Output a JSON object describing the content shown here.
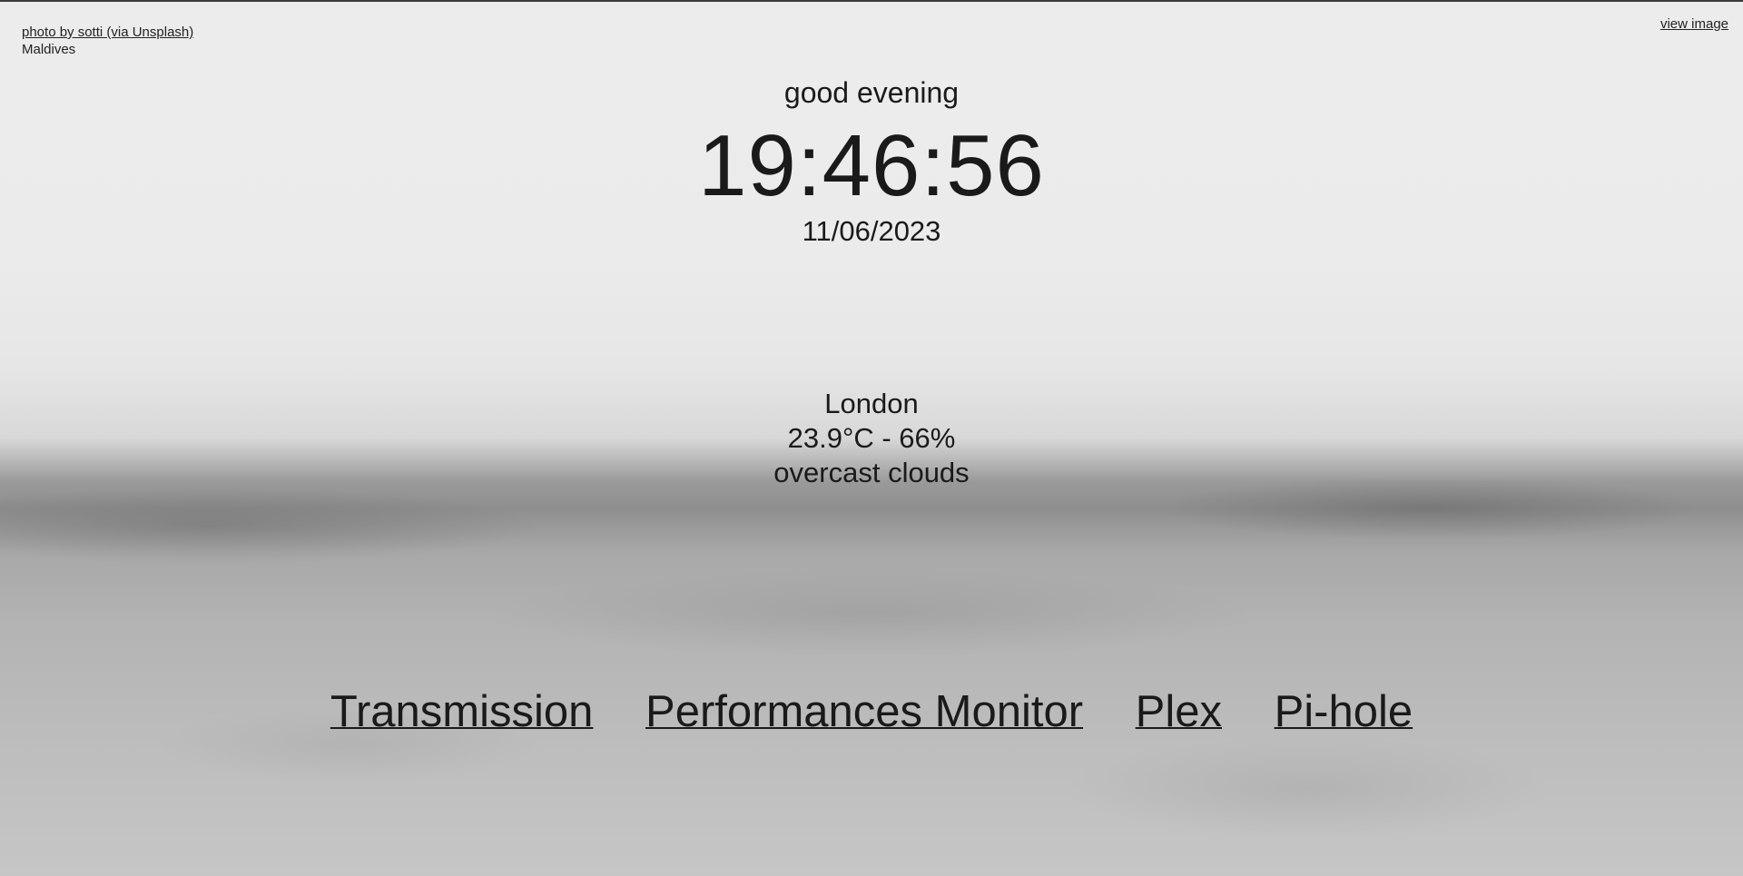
{
  "credit": {
    "photo_link": "photo by sotti (via Unsplash)",
    "location": "Maldives"
  },
  "view_image_label": "view image",
  "greeting": "good evening",
  "clock": "19:46:56",
  "date": "11/06/2023",
  "weather": {
    "city": "London",
    "temp_humidity": "23.9°C - 66%",
    "description": "overcast clouds"
  },
  "links": [
    {
      "label": "Transmission"
    },
    {
      "label": "Performances Monitor"
    },
    {
      "label": "Plex"
    },
    {
      "label": "Pi-hole"
    }
  ]
}
